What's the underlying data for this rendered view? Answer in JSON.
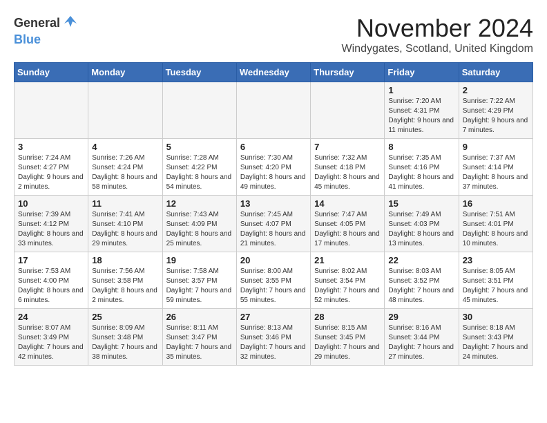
{
  "logo": {
    "general": "General",
    "blue": "Blue"
  },
  "header": {
    "month_title": "November 2024",
    "location": "Windygates, Scotland, United Kingdom"
  },
  "days_of_week": [
    "Sunday",
    "Monday",
    "Tuesday",
    "Wednesday",
    "Thursday",
    "Friday",
    "Saturday"
  ],
  "weeks": [
    [
      {
        "day": "",
        "info": ""
      },
      {
        "day": "",
        "info": ""
      },
      {
        "day": "",
        "info": ""
      },
      {
        "day": "",
        "info": ""
      },
      {
        "day": "",
        "info": ""
      },
      {
        "day": "1",
        "info": "Sunrise: 7:20 AM\nSunset: 4:31 PM\nDaylight: 9 hours and 11 minutes."
      },
      {
        "day": "2",
        "info": "Sunrise: 7:22 AM\nSunset: 4:29 PM\nDaylight: 9 hours and 7 minutes."
      }
    ],
    [
      {
        "day": "3",
        "info": "Sunrise: 7:24 AM\nSunset: 4:27 PM\nDaylight: 9 hours and 2 minutes."
      },
      {
        "day": "4",
        "info": "Sunrise: 7:26 AM\nSunset: 4:24 PM\nDaylight: 8 hours and 58 minutes."
      },
      {
        "day": "5",
        "info": "Sunrise: 7:28 AM\nSunset: 4:22 PM\nDaylight: 8 hours and 54 minutes."
      },
      {
        "day": "6",
        "info": "Sunrise: 7:30 AM\nSunset: 4:20 PM\nDaylight: 8 hours and 49 minutes."
      },
      {
        "day": "7",
        "info": "Sunrise: 7:32 AM\nSunset: 4:18 PM\nDaylight: 8 hours and 45 minutes."
      },
      {
        "day": "8",
        "info": "Sunrise: 7:35 AM\nSunset: 4:16 PM\nDaylight: 8 hours and 41 minutes."
      },
      {
        "day": "9",
        "info": "Sunrise: 7:37 AM\nSunset: 4:14 PM\nDaylight: 8 hours and 37 minutes."
      }
    ],
    [
      {
        "day": "10",
        "info": "Sunrise: 7:39 AM\nSunset: 4:12 PM\nDaylight: 8 hours and 33 minutes."
      },
      {
        "day": "11",
        "info": "Sunrise: 7:41 AM\nSunset: 4:10 PM\nDaylight: 8 hours and 29 minutes."
      },
      {
        "day": "12",
        "info": "Sunrise: 7:43 AM\nSunset: 4:09 PM\nDaylight: 8 hours and 25 minutes."
      },
      {
        "day": "13",
        "info": "Sunrise: 7:45 AM\nSunset: 4:07 PM\nDaylight: 8 hours and 21 minutes."
      },
      {
        "day": "14",
        "info": "Sunrise: 7:47 AM\nSunset: 4:05 PM\nDaylight: 8 hours and 17 minutes."
      },
      {
        "day": "15",
        "info": "Sunrise: 7:49 AM\nSunset: 4:03 PM\nDaylight: 8 hours and 13 minutes."
      },
      {
        "day": "16",
        "info": "Sunrise: 7:51 AM\nSunset: 4:01 PM\nDaylight: 8 hours and 10 minutes."
      }
    ],
    [
      {
        "day": "17",
        "info": "Sunrise: 7:53 AM\nSunset: 4:00 PM\nDaylight: 8 hours and 6 minutes."
      },
      {
        "day": "18",
        "info": "Sunrise: 7:56 AM\nSunset: 3:58 PM\nDaylight: 8 hours and 2 minutes."
      },
      {
        "day": "19",
        "info": "Sunrise: 7:58 AM\nSunset: 3:57 PM\nDaylight: 7 hours and 59 minutes."
      },
      {
        "day": "20",
        "info": "Sunrise: 8:00 AM\nSunset: 3:55 PM\nDaylight: 7 hours and 55 minutes."
      },
      {
        "day": "21",
        "info": "Sunrise: 8:02 AM\nSunset: 3:54 PM\nDaylight: 7 hours and 52 minutes."
      },
      {
        "day": "22",
        "info": "Sunrise: 8:03 AM\nSunset: 3:52 PM\nDaylight: 7 hours and 48 minutes."
      },
      {
        "day": "23",
        "info": "Sunrise: 8:05 AM\nSunset: 3:51 PM\nDaylight: 7 hours and 45 minutes."
      }
    ],
    [
      {
        "day": "24",
        "info": "Sunrise: 8:07 AM\nSunset: 3:49 PM\nDaylight: 7 hours and 42 minutes."
      },
      {
        "day": "25",
        "info": "Sunrise: 8:09 AM\nSunset: 3:48 PM\nDaylight: 7 hours and 38 minutes."
      },
      {
        "day": "26",
        "info": "Sunrise: 8:11 AM\nSunset: 3:47 PM\nDaylight: 7 hours and 35 minutes."
      },
      {
        "day": "27",
        "info": "Sunrise: 8:13 AM\nSunset: 3:46 PM\nDaylight: 7 hours and 32 minutes."
      },
      {
        "day": "28",
        "info": "Sunrise: 8:15 AM\nSunset: 3:45 PM\nDaylight: 7 hours and 29 minutes."
      },
      {
        "day": "29",
        "info": "Sunrise: 8:16 AM\nSunset: 3:44 PM\nDaylight: 7 hours and 27 minutes."
      },
      {
        "day": "30",
        "info": "Sunrise: 8:18 AM\nSunset: 3:43 PM\nDaylight: 7 hours and 24 minutes."
      }
    ]
  ]
}
